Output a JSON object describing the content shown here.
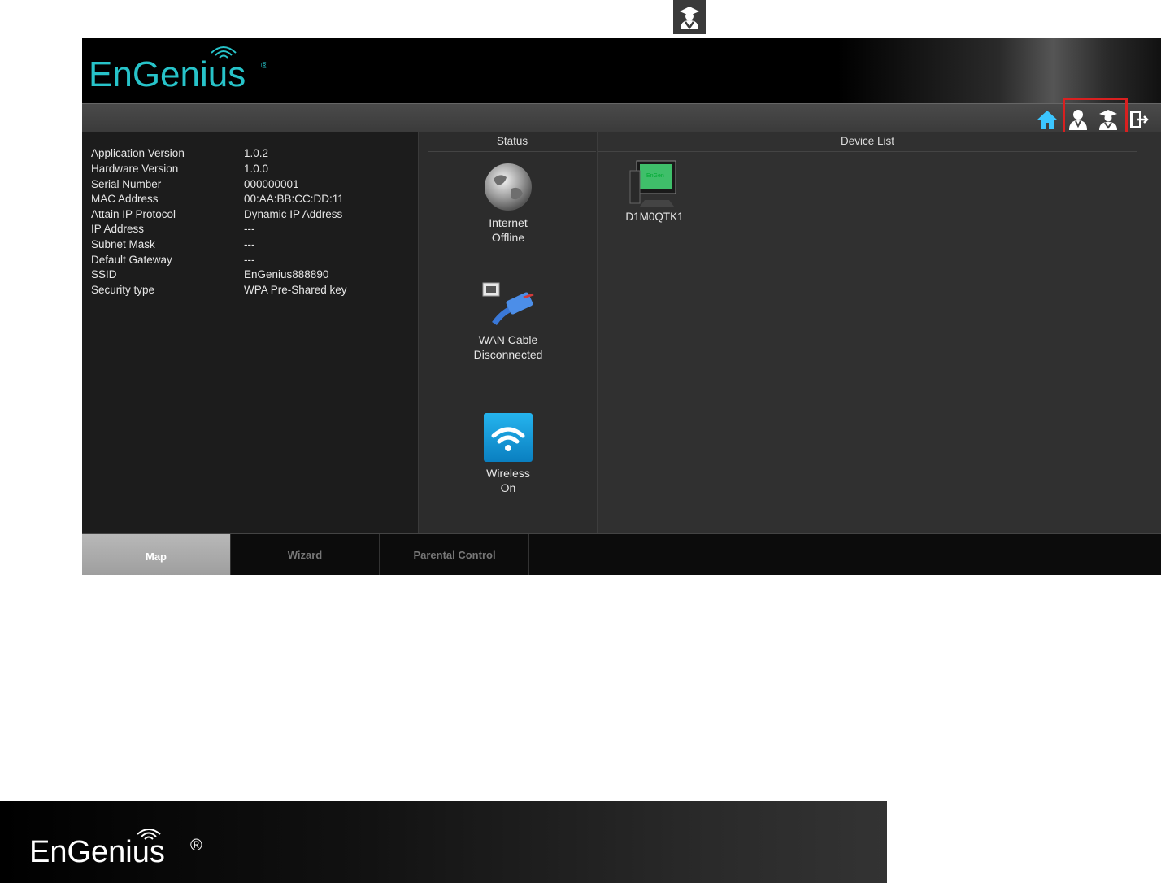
{
  "brand": {
    "logo_text": "EnGenius",
    "reg_mark": "®",
    "accent_color": "#27c3c9"
  },
  "toolbar": {
    "icons": [
      "home-icon",
      "user-icon",
      "admin-user-icon",
      "logout-icon"
    ],
    "highlight_color": "#d92020"
  },
  "info": {
    "rows": [
      {
        "label": "Application Version",
        "value": "1.0.2"
      },
      {
        "label": "Hardware Version",
        "value": "1.0.0"
      },
      {
        "label": "Serial Number",
        "value": "000000001"
      },
      {
        "label": "MAC Address",
        "value": "00:AA:BB:CC:DD:11"
      },
      {
        "label": "Attain IP Protocol",
        "value": "Dynamic IP Address"
      },
      {
        "label": "IP Address",
        "value": "---"
      },
      {
        "label": "Subnet Mask",
        "value": "---"
      },
      {
        "label": "Default Gateway",
        "value": "---"
      },
      {
        "label": "SSID",
        "value": "EnGenius888890"
      },
      {
        "label": "Security type",
        "value": "WPA Pre-Shared key"
      }
    ]
  },
  "status": {
    "header": "Status",
    "items": [
      {
        "icon": "globe-icon",
        "line1": "Internet",
        "line2": "Offline"
      },
      {
        "icon": "ethernet-cable-icon",
        "line1": "WAN Cable",
        "line2": "Disconnected"
      },
      {
        "icon": "wireless-icon",
        "line1": "Wireless",
        "line2": "On"
      }
    ]
  },
  "device_list": {
    "header": "Device List",
    "devices": [
      {
        "icon": "computer-icon",
        "name": "D1M0QTK1"
      }
    ]
  },
  "tabs": [
    {
      "label": "Map",
      "active": true
    },
    {
      "label": "Wizard",
      "active": false
    },
    {
      "label": "Parental Control",
      "active": false
    }
  ],
  "footer": {
    "logo_text": "EnGenius",
    "reg_mark": "®"
  }
}
